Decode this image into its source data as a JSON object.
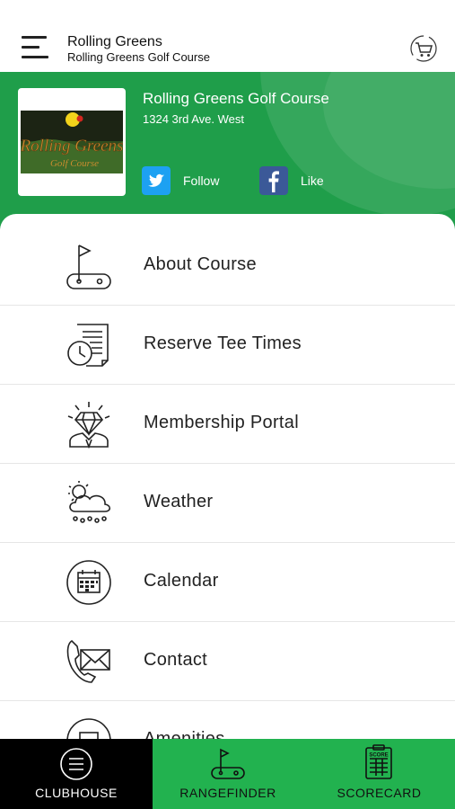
{
  "header": {
    "title": "Rolling Greens",
    "subtitle": "Rolling Greens Golf Course"
  },
  "course": {
    "name": "Rolling Greens Golf Course",
    "address": "1324 3rd Ave. West",
    "logo_text_line1": "Rolling Greens",
    "logo_text_line2": "Golf Course",
    "social": {
      "twitter_label": "Follow",
      "facebook_label": "Like"
    }
  },
  "menu": {
    "items": [
      {
        "label": "About Course",
        "icon": "golf-flag-icon"
      },
      {
        "label": "Reserve Tee Times",
        "icon": "tee-times-clock-icon"
      },
      {
        "label": "Membership Portal",
        "icon": "member-diamond-icon"
      },
      {
        "label": "Weather",
        "icon": "weather-cloud-icon"
      },
      {
        "label": "Calendar",
        "icon": "calendar-icon"
      },
      {
        "label": "Contact",
        "icon": "phone-mail-icon"
      },
      {
        "label": "Amenities",
        "icon": "amenities-icon"
      }
    ]
  },
  "tabs": {
    "clubhouse": "CLUBHOUSE",
    "rangefinder": "RANGEFINDER",
    "scorecard": "SCORECARD",
    "scorecard_icon_text": "SCORE"
  },
  "colors": {
    "brand_green": "#1f9e4a",
    "tab_green": "#22b24f",
    "active_tab": "#000000",
    "twitter": "#1da1f2",
    "facebook": "#3b5998"
  }
}
